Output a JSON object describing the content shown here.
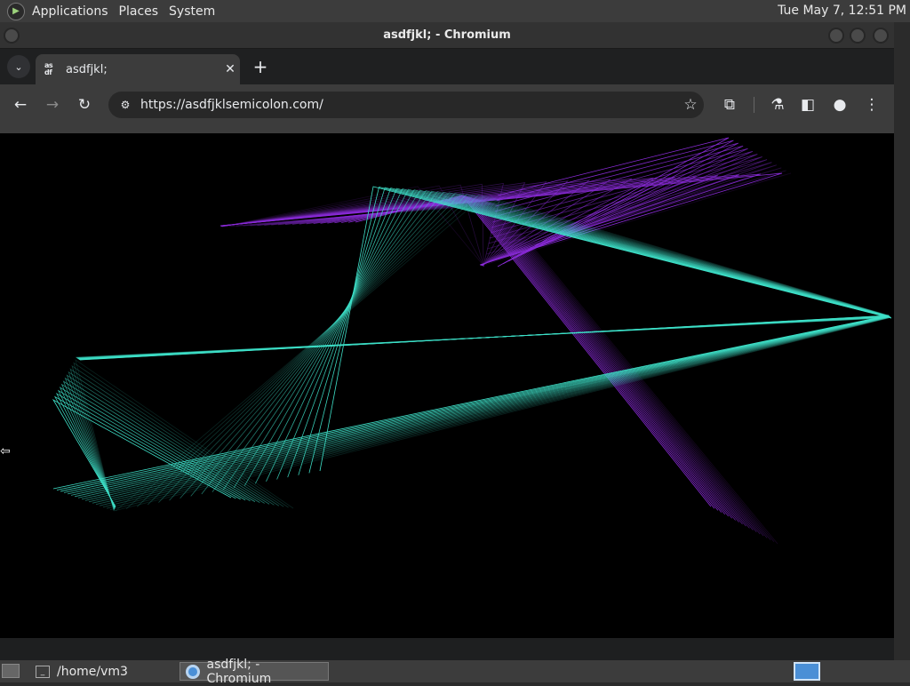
{
  "top_panel": {
    "menus": [
      "Applications",
      "Places",
      "System"
    ],
    "clock": "Tue May  7, 12:51 PM"
  },
  "window": {
    "title": "asdfjkl; - Chromium"
  },
  "tab": {
    "favicon_text": "as\ndf",
    "title": "asdfjkl;",
    "close_glyph": "✕"
  },
  "toolbar": {
    "url": "https://asdfjklsemicolon.com/"
  },
  "taskbar": {
    "items": [
      "/home/vm3",
      "asdfjkl; - Chromium"
    ]
  },
  "colors": {
    "cyan": "#3ee0c8",
    "purple": "#8a2bd8",
    "background": "#000000"
  },
  "icons": [
    "back-icon",
    "forward-icon",
    "reload-icon",
    "site-info-icon",
    "star-icon",
    "extensions-icon",
    "labs-icon",
    "sidepanel-icon",
    "profile-icon",
    "menu-icon"
  ]
}
